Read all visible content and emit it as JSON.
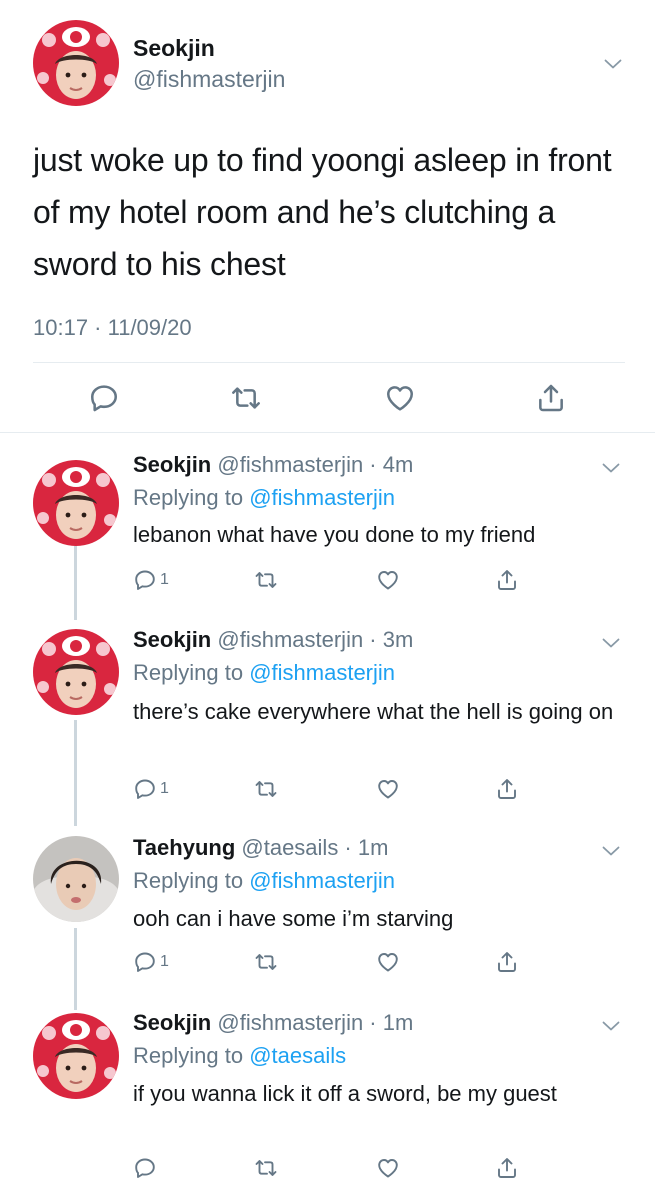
{
  "main": {
    "name": "Seokjin",
    "handle": "@fishmasterjin",
    "text": "just woke up to find yoongi asleep in front of my hotel room and he’s clutching a sword to his chest",
    "timestamp": "10:17 · 11/09/20",
    "actions": [
      "reply-icon",
      "retweet-icon",
      "like-icon",
      "share-icon"
    ]
  },
  "replies": [
    {
      "name": "Seokjin",
      "meta": "@fishmasterjin · 4m",
      "replying_prefix": "Replying to",
      "replying_to": "@fishmasterjin",
      "text": "lebanon what have you done to my friend",
      "reply_count": "1"
    },
    {
      "name": "Seokjin",
      "meta": "@fishmasterjin · 3m",
      "replying_prefix": "Replying to",
      "replying_to": "@fishmasterjin",
      "text": "there’s cake everywhere what the hell is going on",
      "reply_count": "1"
    },
    {
      "name": "Taehyung",
      "meta": "@taesails · 1m",
      "replying_prefix": "Replying to",
      "replying_to": "@fishmasterjin",
      "text": "ooh can i have some i’m starving",
      "reply_count": "1"
    },
    {
      "name": "Seokjin",
      "meta": "@fishmasterjin · 1m",
      "replying_prefix": "Replying to",
      "replying_to": "@taesails",
      "text": "if you wanna lick it off a sword, be my guest",
      "reply_count": ""
    }
  ],
  "colors": {
    "text": "#14171a",
    "secondary": "#657786",
    "link": "#1da1f2",
    "divider": "#e6ecf0",
    "thread_line": "#ccd6dd"
  }
}
